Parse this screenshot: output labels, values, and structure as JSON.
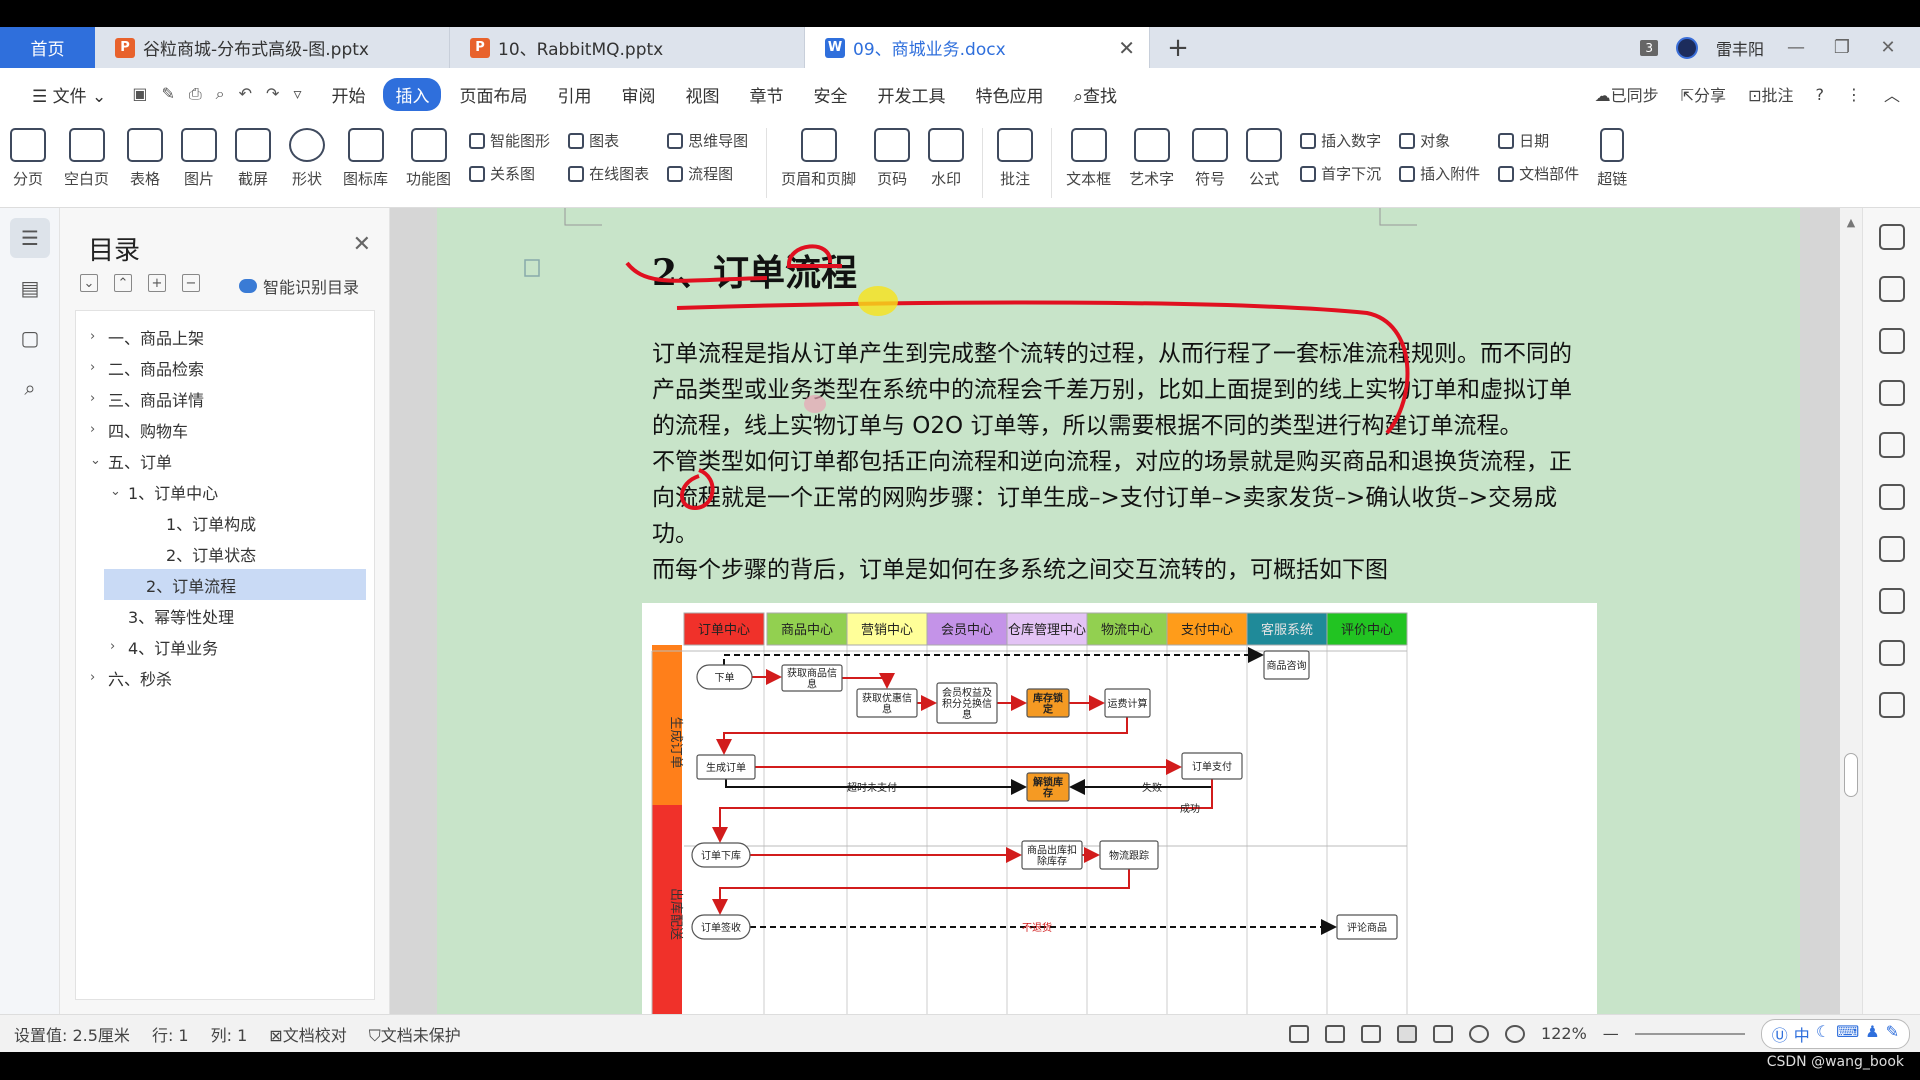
{
  "tabs": {
    "home": "首页",
    "items": [
      {
        "label": "谷粒商城-分布式高级-图.pptx",
        "type": "P"
      },
      {
        "label": "10、RabbitMQ.pptx",
        "type": "P"
      },
      {
        "label": "09、商城业务.docx",
        "type": "W"
      }
    ],
    "count_badge": "3",
    "user": "雷丰阳"
  },
  "menu": {
    "file": "文件",
    "items": [
      "开始",
      "插入",
      "页面布局",
      "引用",
      "审阅",
      "视图",
      "章节",
      "安全",
      "开发工具",
      "特色应用"
    ],
    "search": "查找",
    "active": "插入",
    "sync": "已同步",
    "share": "分享",
    "comment": "批注"
  },
  "ribbon": {
    "big1": [
      "分页",
      "空白页",
      "表格",
      "图片",
      "截屏",
      "形状",
      "图标库",
      "功能图"
    ],
    "small1": [
      "智能图形",
      "关系图"
    ],
    "small2": [
      "图表",
      "在线图表"
    ],
    "small3": [
      "思维导图",
      "流程图"
    ],
    "big2": [
      "页眉和页脚",
      "页码",
      "水印",
      "批注",
      "文本框",
      "艺术字",
      "符号",
      "公式"
    ],
    "small4": [
      "插入数字",
      "首字下沉"
    ],
    "small5": [
      "对象",
      "插入附件"
    ],
    "small6": [
      "日期",
      "文档部件"
    ],
    "last": "超链"
  },
  "toc": {
    "title": "目录",
    "smart": "智能识别目录",
    "items": [
      {
        "label": "一、商品上架",
        "level": 1,
        "arrow": "›"
      },
      {
        "label": "二、商品检索",
        "level": 1,
        "arrow": "›"
      },
      {
        "label": "三、商品详情",
        "level": 1,
        "arrow": "›"
      },
      {
        "label": "四、购物车",
        "level": 1,
        "arrow": "›"
      },
      {
        "label": "五、订单",
        "level": 1,
        "arrow": "⌄"
      },
      {
        "label": "1、订单中心",
        "level": 2,
        "arrow": "⌄"
      },
      {
        "label": "1、订单构成",
        "level": 3,
        "arrow": ""
      },
      {
        "label": "2、订单状态",
        "level": 3,
        "arrow": ""
      },
      {
        "label": "2、订单流程",
        "level": 2,
        "arrow": "",
        "selected": true
      },
      {
        "label": "3、幂等性处理",
        "level": 2,
        "arrow": ""
      },
      {
        "label": "4、订单业务",
        "level": 2,
        "arrow": "›"
      },
      {
        "label": "六、秒杀",
        "level": 1,
        "arrow": "›"
      }
    ]
  },
  "doc": {
    "heading": "2、订单流程",
    "lines": [
      "订单流程是指从订单产生到完成整个流转的过程，从而行程了一套标准流程规则。而不同的",
      "产品类型或业务类型在系统中的流程会千差万别，比如上面提到的线上实物订单和虚拟订单",
      "的流程，线上实物订单与 O2O 订单等，所以需要根据不同的类型进行构建订单流程。",
      "不管类型如何订单都包括正向流程和逆向流程，对应的场景就是购买商品和退换货流程，正",
      "向流程就是一个正常的网购步骤：订单生成–>支付订单–>卖家发货–>确认收货–>交易成功。",
      "而每个步骤的背后，订单是如何在多系统之间交互流转的，可概括如下图"
    ]
  },
  "diagram": {
    "columns": [
      {
        "label": "订单中心",
        "color": "#f0312a"
      },
      {
        "label": "商品中心",
        "color": "#92d050"
      },
      {
        "label": "营销中心",
        "color": "#ffff99"
      },
      {
        "label": "会员中心",
        "color": "#c493e8"
      },
      {
        "label": "仓库管理中心",
        "color": "#e3c3f5"
      },
      {
        "label": "物流中心",
        "color": "#92d050"
      },
      {
        "label": "支付中心",
        "color": "#ff9c1a"
      },
      {
        "label": "客服系统",
        "color": "#1f8a99"
      },
      {
        "label": "评价中心",
        "color": "#22c422"
      }
    ],
    "lanes": [
      {
        "label": "生成订单",
        "color": "#ff7f1a"
      },
      {
        "label": "出库配送",
        "color": "#f0312a"
      }
    ],
    "nodes": {
      "xiadan": "下单",
      "huoqu": "获取商品信息",
      "youhui": "获取优惠信息",
      "huiyuan": "会员权益及积分兑换信息",
      "kucun": "库存锁定",
      "yunfei": "运费计算",
      "kefu": "商品咨询",
      "shengcheng": "生成订单",
      "zhifu": "订单支付",
      "jiesuo": "解锁库存",
      "xiaku": "订单下库",
      "chuku": "商品出库扣除库存",
      "wuliu": "物流跟踪",
      "qianshou": "订单签收",
      "pinglun": "评论商品"
    },
    "edges": {
      "chaoshi": "超时未支付",
      "shibai": "失败",
      "chenggong": "成功",
      "butuihuo": "不退货"
    }
  },
  "status": {
    "setting": "设置值: 2.5厘米",
    "row": "行: 1",
    "col": "列: 1",
    "check": "文档校对",
    "protect": "文档未保护",
    "zoom": "122%",
    "ime": "中"
  },
  "watermark": "CSDN @wang_book"
}
